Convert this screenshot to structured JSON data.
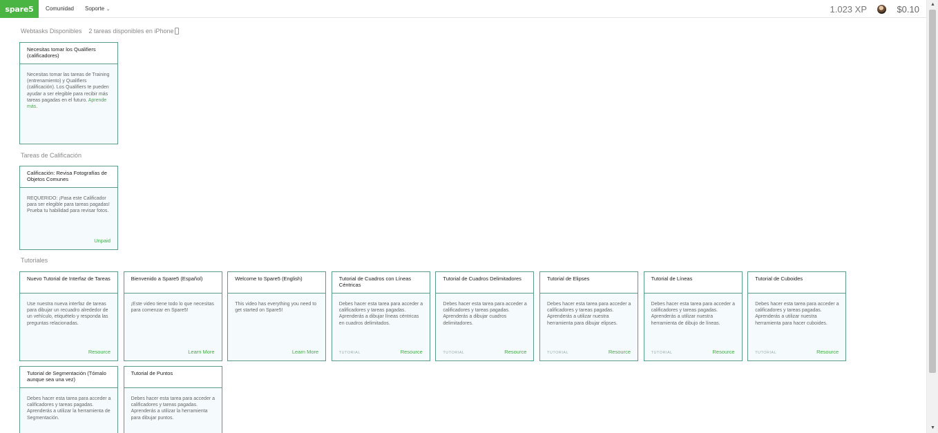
{
  "nav": {
    "logo": "spare5",
    "community": "Comunidad",
    "support": "Soporte",
    "caret": "⌄",
    "xp": "1.023 XP",
    "balance": "$0.10"
  },
  "colors": {
    "accent": "#4bb543",
    "card_border": "#5a9a89",
    "card_bg": "#f5fbfc",
    "link": "#45a94a"
  },
  "sections": {
    "webtasks": {
      "title": "Webtasks Disponibles",
      "note": "2 tareas disponibles en iPhone"
    },
    "qualification": {
      "title": "Tareas de Calificación"
    },
    "tutorials": {
      "title": "Tutoriales"
    }
  },
  "cards": {
    "qualifiers": {
      "title": "Necesitas tomar los Qualifiers (calificadores)",
      "body": "Necesitas tomar las tareas de Training (entrenamiento) y Qualifiers (calificación). Los Qualifiers te pueden ayudar a ser elegible para recibir más tareas pagadas en el futuro. ",
      "link": "Aprende más."
    },
    "calificacion": {
      "title": "Calificación: Revisa Fotografías de Objetos Comunes",
      "body": "REQUERIDO: ¡Pasa este Calificador para ser elegible para tareas pagadas! Prueba tu habilidad para revisar fotos.",
      "foot": "Unpaid"
    },
    "tutorials": [
      {
        "title": "Nuevo Tutorial de Interfaz de Tareas",
        "body": "Use nuestra nueva interfaz de tareas para dibujar un recuadro alrededor de un vehículo, etiquételo y responda las preguntas relacionadas.",
        "tag": "",
        "foot": "Resource"
      },
      {
        "title": "Bienvenido a Spare5 (Español)",
        "body": "¡Este video tiene todo lo que necesitas para comenzar en Spare5!",
        "tag": "",
        "foot": "Learn More"
      },
      {
        "title": "Welcome to Spare5 (English)",
        "body": "This video has everything you need to get started on Spare5!",
        "tag": "",
        "foot": "Learn More"
      },
      {
        "title": "Tutorial de Cuadros con Líneas Céntricas",
        "body": "Debes hacer esta tarea para acceder a calificadores y tareas pagadas. Aprenderás a dibujar líneas céntricas en cuadros delimitados.",
        "tag": "TUTORIAL",
        "foot": "Resource"
      },
      {
        "title": "Tutorial de Cuadros Delimitadores",
        "body": "Debes hacer esta tarea para acceder a calificadores y tareas pagadas. Aprenderás a dibujar cuadros delimitadores.",
        "tag": "TUTORIAL",
        "foot": "Resource"
      },
      {
        "title": "Tutorial de Elipses",
        "body": "Debes hacer esta tarea para acceder a calificadores y tareas pagadas. Aprenderás a utilizar nuestra herramienta para dibujar elipses.",
        "tag": "TUTORIAL",
        "foot": "Resource"
      },
      {
        "title": "Tutorial de Líneas",
        "body": "Debes hacer esta tarea para acceder a calificadores y tareas pagadas. Aprenderás a utilizar nuestra herramienta de dibujo de líneas.",
        "tag": "TUTORIAL",
        "foot": "Resource"
      },
      {
        "title": "Tutorial de Cuboides",
        "body": "Debes hacer esta tarea para acceder a calificadores y tareas pagadas. Aprenderás a utilizar nuestra herramienta para hacer cuboides.",
        "tag": "TUTORIAL",
        "foot": "Resource"
      },
      {
        "title": "Tutorial de Segmentación (Tómalo aunque sea una vez)",
        "body": "Debes hacer esta tarea para acceder a calificadores y tareas pagadas. Aprenderás a utilizar la herramienta de Segmentación.",
        "tag": "",
        "foot": ""
      },
      {
        "title": "Tutorial de Puntos",
        "body": "Debes hacer esta tarea para acceder a calificadores y tareas pagadas. Aprenderás a utilizar la herramienta para dibujar puntos.",
        "tag": "",
        "foot": ""
      }
    ]
  }
}
